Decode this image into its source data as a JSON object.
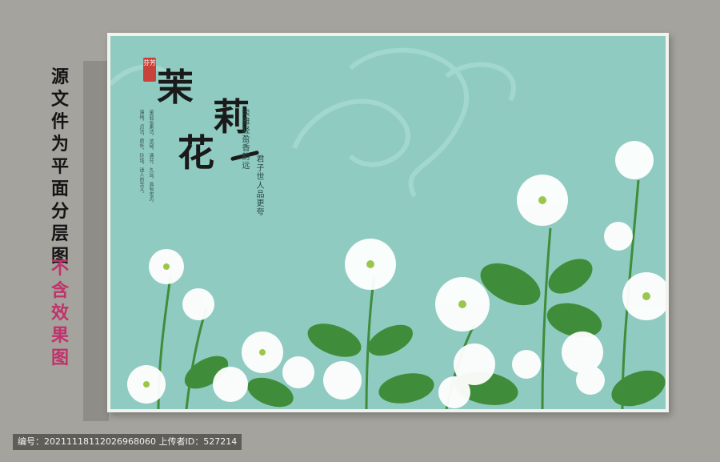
{
  "side_text": {
    "line1": "源文件为平面分层图",
    "line2": "不含效果图"
  },
  "artwork": {
    "title_chars": [
      "茉",
      "莉",
      "花"
    ],
    "seal_text": "芬芳",
    "poem_line1": "淡雅轻盈香韵远",
    "poem_line2": "君子世人品更夸",
    "small_cols": [
      "清纯，贞洁，质朴，玲珑，迷人的含义。",
      "茉莉花素洁，浓郁，清芬，久远，具有忠贞、"
    ]
  },
  "footer": {
    "id_label": "编号：",
    "id_value": "20211118112026968060",
    "uploader_label": "上传者ID：",
    "uploader_value": "527214"
  },
  "colors": {
    "background": "#a4a39d",
    "canvas": "#8fcbc1",
    "accent_pink": "#c0326b",
    "leaf": "#3f8d3a"
  }
}
